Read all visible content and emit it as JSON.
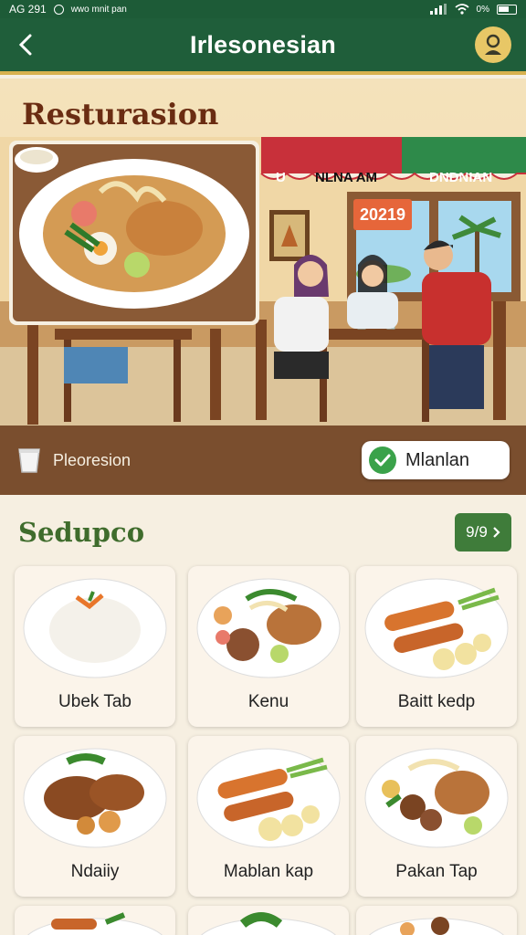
{
  "status_bar": {
    "time": "AG 291",
    "carrier": "wwo mnit pan",
    "battery": "0%"
  },
  "app_bar": {
    "title": "Irlesonesian"
  },
  "hero": {
    "title": "Resturasion",
    "awning_left": "U",
    "awning_middle": "NLNA AM",
    "awning_right": "DNDNIAN",
    "sign_year": "20219",
    "bar_label": "Pleoresion",
    "menu_button": "Mlanlan"
  },
  "section": {
    "title": "Sedupco",
    "pager": "9/9"
  },
  "cards": [
    {
      "name": "Ubek Tab"
    },
    {
      "name": "Kenu"
    },
    {
      "name": "Baitt kedp"
    },
    {
      "name": "Ndaiiy"
    },
    {
      "name": "Mablan kap"
    },
    {
      "name": "Pakan Tap"
    }
  ],
  "colors": {
    "brand_green": "#1f5e3a",
    "accent_gold": "#d8b24f",
    "section_green": "#3f6c2c",
    "brown": "#7a4e2e"
  }
}
